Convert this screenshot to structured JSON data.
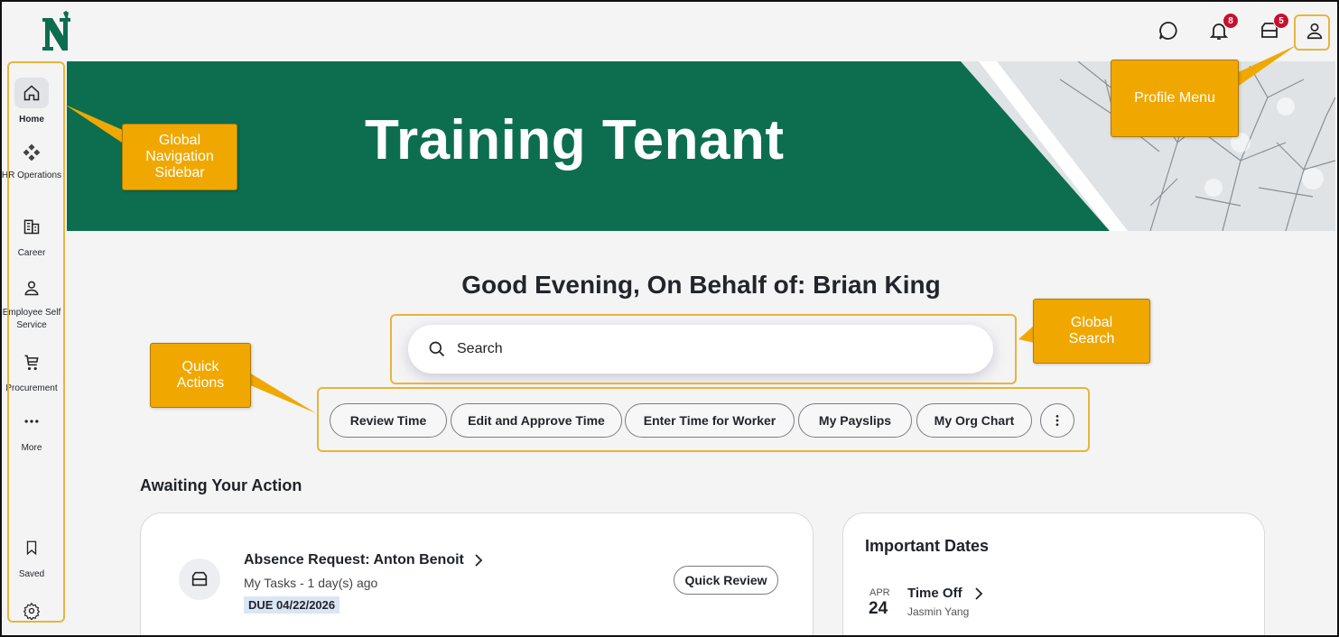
{
  "header": {
    "badges": {
      "notifications": "8",
      "inbox": "5"
    }
  },
  "sidebar": {
    "items": [
      {
        "label": "Home",
        "icon": "home-icon"
      },
      {
        "label": "HR Operations",
        "icon": "apps-icon"
      },
      {
        "label": "Career",
        "icon": "building-icon"
      },
      {
        "label": "Employee Self Service",
        "icon": "person-icon"
      },
      {
        "label": "Procurement",
        "icon": "cart-icon"
      },
      {
        "label": "More",
        "icon": "more-dots-icon"
      },
      {
        "label": "Saved",
        "icon": "bookmark-icon"
      }
    ]
  },
  "banner": {
    "title": "Training Tenant"
  },
  "main": {
    "greeting": "Good Evening, On Behalf of: Brian King",
    "search": {
      "placeholder": "Search"
    },
    "quick_actions": [
      "Review Time",
      "Edit and Approve Time",
      "Enter Time for Worker",
      "My Payslips",
      "My Org Chart"
    ],
    "awaiting_title": "Awaiting Your Action",
    "task": {
      "title": "Absence Request: Anton Benoit",
      "subtitle": "My Tasks - 1 day(s) ago",
      "due": "DUE 04/22/2026",
      "action": "Quick Review"
    },
    "important_dates": {
      "title": "Important Dates",
      "month": "APR",
      "day": "24",
      "event": "Time Off",
      "person": "Jasmin Yang"
    }
  },
  "annotations": {
    "sidebar": "Global Navigation Sidebar",
    "profile": "Profile Menu",
    "search": "Global Search",
    "quick_actions": "Quick Actions"
  },
  "colors": {
    "banner": "#0c6e4f",
    "callout": "#f0a800",
    "badge": "#c8102e"
  }
}
